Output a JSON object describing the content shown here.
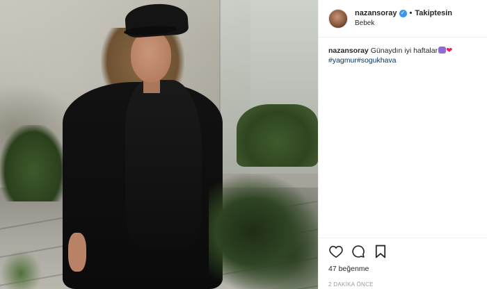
{
  "post": {
    "username": "nazansoray",
    "follow_label": "Takiptesin",
    "separator": "•",
    "location": "Bebek",
    "caption": {
      "username": "nazansoray",
      "text": "Günaydın iyi haftalar",
      "hashtags": [
        "#yagmur",
        "#sogukhava"
      ]
    },
    "likes_text": "47 beğenme",
    "timestamp": "2 DAKİKA ÖNCE"
  },
  "icons": {
    "verified": "verified-badge-icon",
    "like": "heart-icon",
    "comment": "comment-bubble-icon",
    "save": "bookmark-icon"
  },
  "colors": {
    "verified": "#3897f0",
    "hashtag": "#003569",
    "heart_emoji": "#e0245e",
    "divider": "#efefef"
  }
}
